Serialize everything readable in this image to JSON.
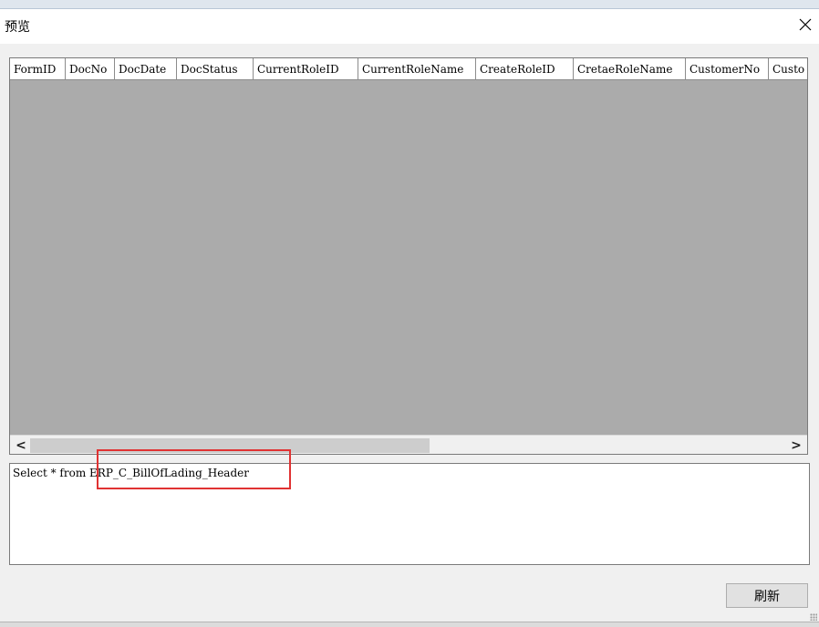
{
  "window": {
    "title": "预览"
  },
  "grid": {
    "columns": [
      "FormID",
      "DocNo",
      "DocDate",
      "DocStatus",
      "CurrentRoleID",
      "CurrentRoleName",
      "CreateRoleID",
      "CretaeRoleName",
      "CustomerNo",
      "Custo"
    ]
  },
  "scrollbar": {
    "left_arrow": "<",
    "right_arrow": ">"
  },
  "sql": {
    "text": "Select * from ERP_C_BillOfLading_Header"
  },
  "buttons": {
    "refresh": "刷新"
  },
  "colors": {
    "grid_background": "#ababab",
    "highlight": "#e03232"
  }
}
